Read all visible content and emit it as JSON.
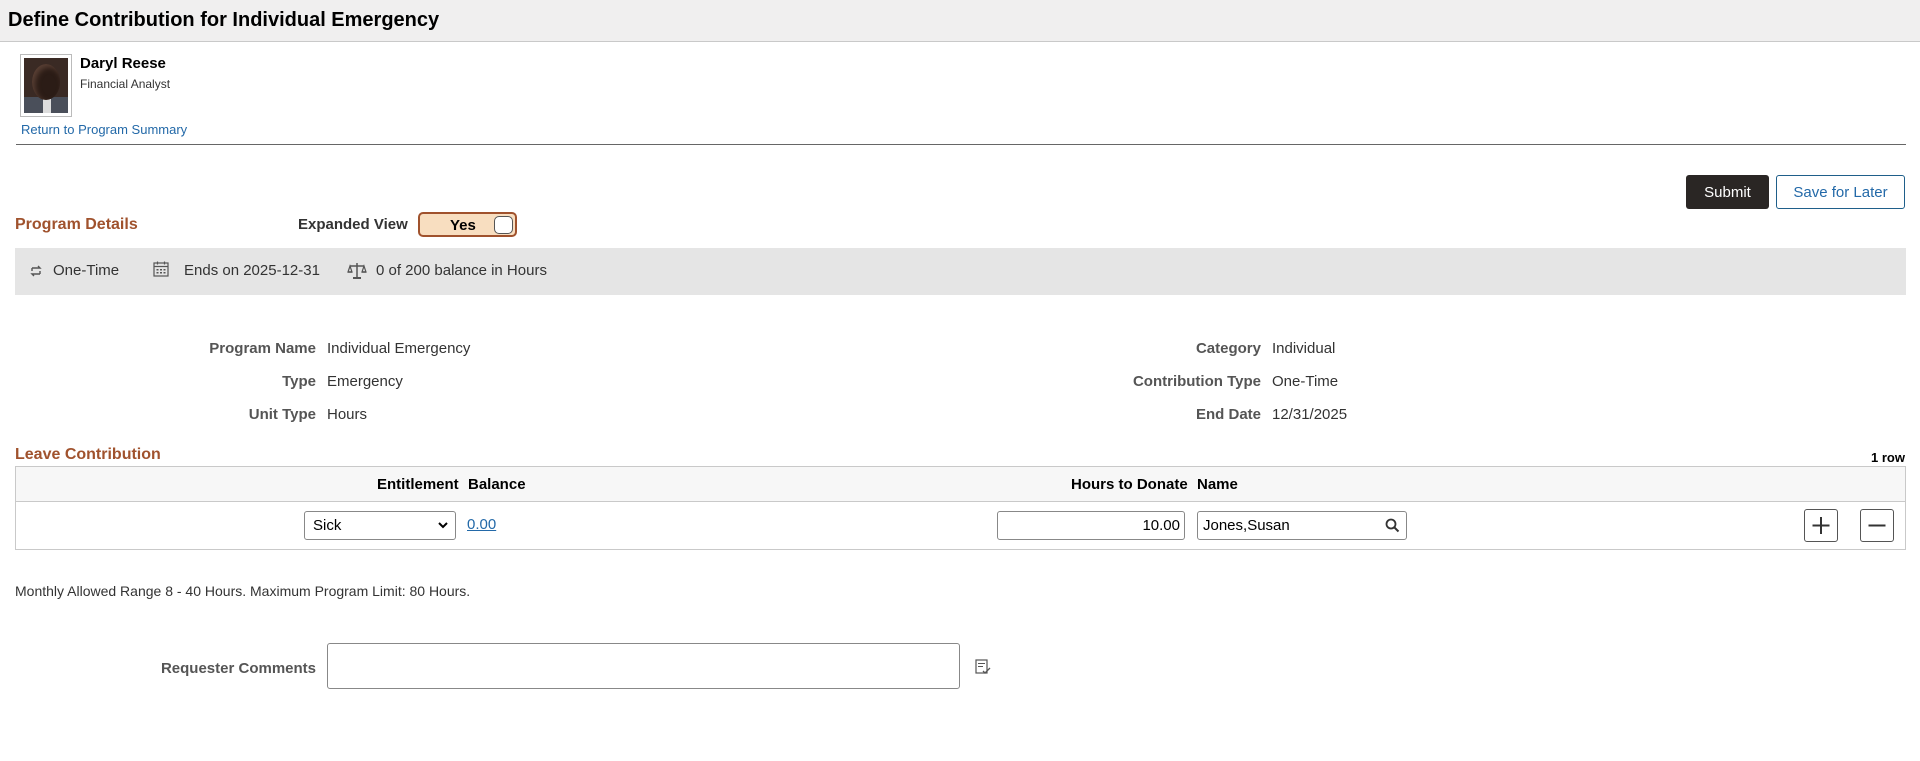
{
  "page": {
    "title": "Define Contribution for Individual Emergency"
  },
  "employee": {
    "name": "Daryl Reese",
    "job_title": "Financial Analyst",
    "return_link": "Return to Program Summary"
  },
  "actions": {
    "submit": "Submit",
    "save_for_later": "Save for Later"
  },
  "program_details": {
    "title": "Program Details",
    "expanded_view_label": "Expanded View",
    "expanded_view_value": "Yes",
    "summary": {
      "frequency": "One-Time",
      "ends_on": "Ends on 2025-12-31",
      "balance": "0 of 200 balance in Hours"
    },
    "fields": {
      "program_name_label": "Program Name",
      "program_name": "Individual Emergency",
      "type_label": "Type",
      "type": "Emergency",
      "unit_type_label": "Unit Type",
      "unit_type": "Hours",
      "category_label": "Category",
      "category": "Individual",
      "contribution_type_label": "Contribution Type",
      "contribution_type": "One-Time",
      "end_date_label": "End Date",
      "end_date": "12/31/2025"
    }
  },
  "leave_contribution": {
    "title": "Leave Contribution",
    "row_count": "1 row",
    "columns": {
      "entitlement": "Entitlement",
      "balance": "Balance",
      "hours_to_donate": "Hours to Donate",
      "name": "Name"
    },
    "rows": [
      {
        "entitlement": "Sick",
        "balance": "0.00",
        "hours_to_donate": "10.00",
        "name": "Jones,Susan"
      }
    ]
  },
  "note": "Monthly Allowed Range 8 - 40 Hours. Maximum Program Limit: 80 Hours.",
  "comments": {
    "label": "Requester Comments",
    "value": ""
  },
  "icons": {
    "frequency": "repeat-icon",
    "calendar": "calendar-icon",
    "balance": "scale-icon",
    "search": "search-icon",
    "add": "plus-icon",
    "delete": "minus-icon",
    "spellcheck": "spellcheck-icon"
  },
  "colors": {
    "accent": "#a0522d",
    "link": "#2369a8",
    "primary_button": "#2a2624",
    "toggle_bg": "#f8dec0"
  }
}
